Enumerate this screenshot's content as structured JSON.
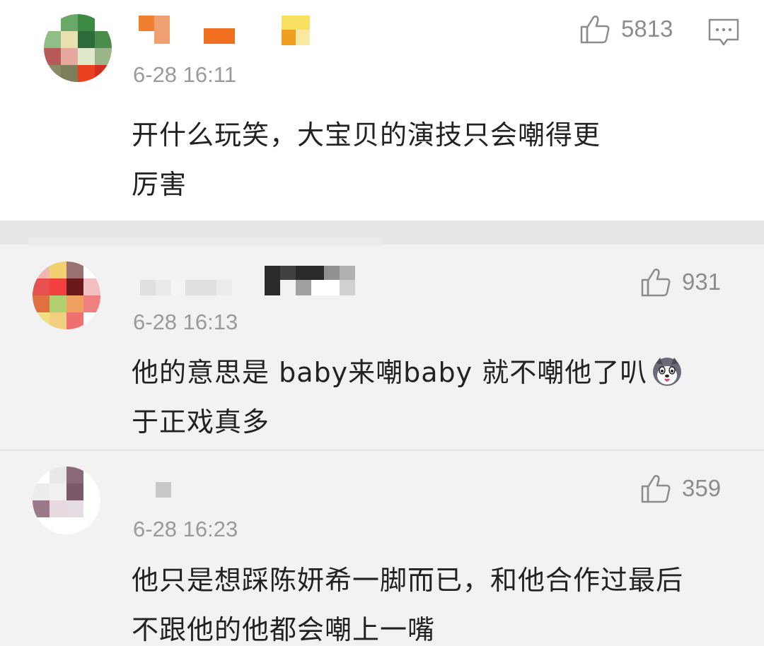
{
  "comments": [
    {
      "time": "6-28 16:11",
      "likes": "5813",
      "content_line1": "开什么玩笑，大宝贝的演技只会嘲得更",
      "content_line2": "厉害",
      "avatar_colors": [
        "#ffffff",
        "#6aa86a",
        "#3d8a45",
        "#ffffff",
        "#8fbf86",
        "#e9e0b0",
        "#2c6b3a",
        "#4a8c4a",
        "#b85a5a",
        "#e6a9a0",
        "#dfe8c8",
        "#9ab58a",
        "#8a8a6a",
        "#7d7d5a",
        "#e84020",
        "#d03020"
      ]
    },
    {
      "time": "6-28 16:13",
      "likes": "931",
      "content_line1": "他的意思是 baby来嘲baby 就不嘲他了叭",
      "content_line2": "于正戏真多",
      "avatar_colors": [
        "#f2b8b0",
        "#f2d070",
        "#9a7070",
        "#ffffff",
        "#e85050",
        "#f24040",
        "#6a1a1a",
        "#f2c0c0",
        "#e07040",
        "#b0d070",
        "#f0a060",
        "#f08080",
        "#f0e080",
        "#f0d080",
        "#f07070",
        "#ffffff"
      ]
    },
    {
      "time": "6-28 16:23",
      "likes": "359",
      "content_line1": "他只是想踩陈妍希一脚而已，和他合作过最后",
      "content_line2": "不跟他的他都会嘲上一嘴",
      "avatar_colors": [
        "#ffffff",
        "#e8e8e8",
        "#8a6a7a",
        "#ffffff",
        "#ececec",
        "#f0f0f0",
        "#7a5a6a",
        "#ffffff",
        "#9a7a8a",
        "#e8d8e0",
        "#e6dce4",
        "#ffffff",
        "#ffffff",
        "#ffffff",
        "#ffffff",
        "#ffffff"
      ]
    }
  ]
}
